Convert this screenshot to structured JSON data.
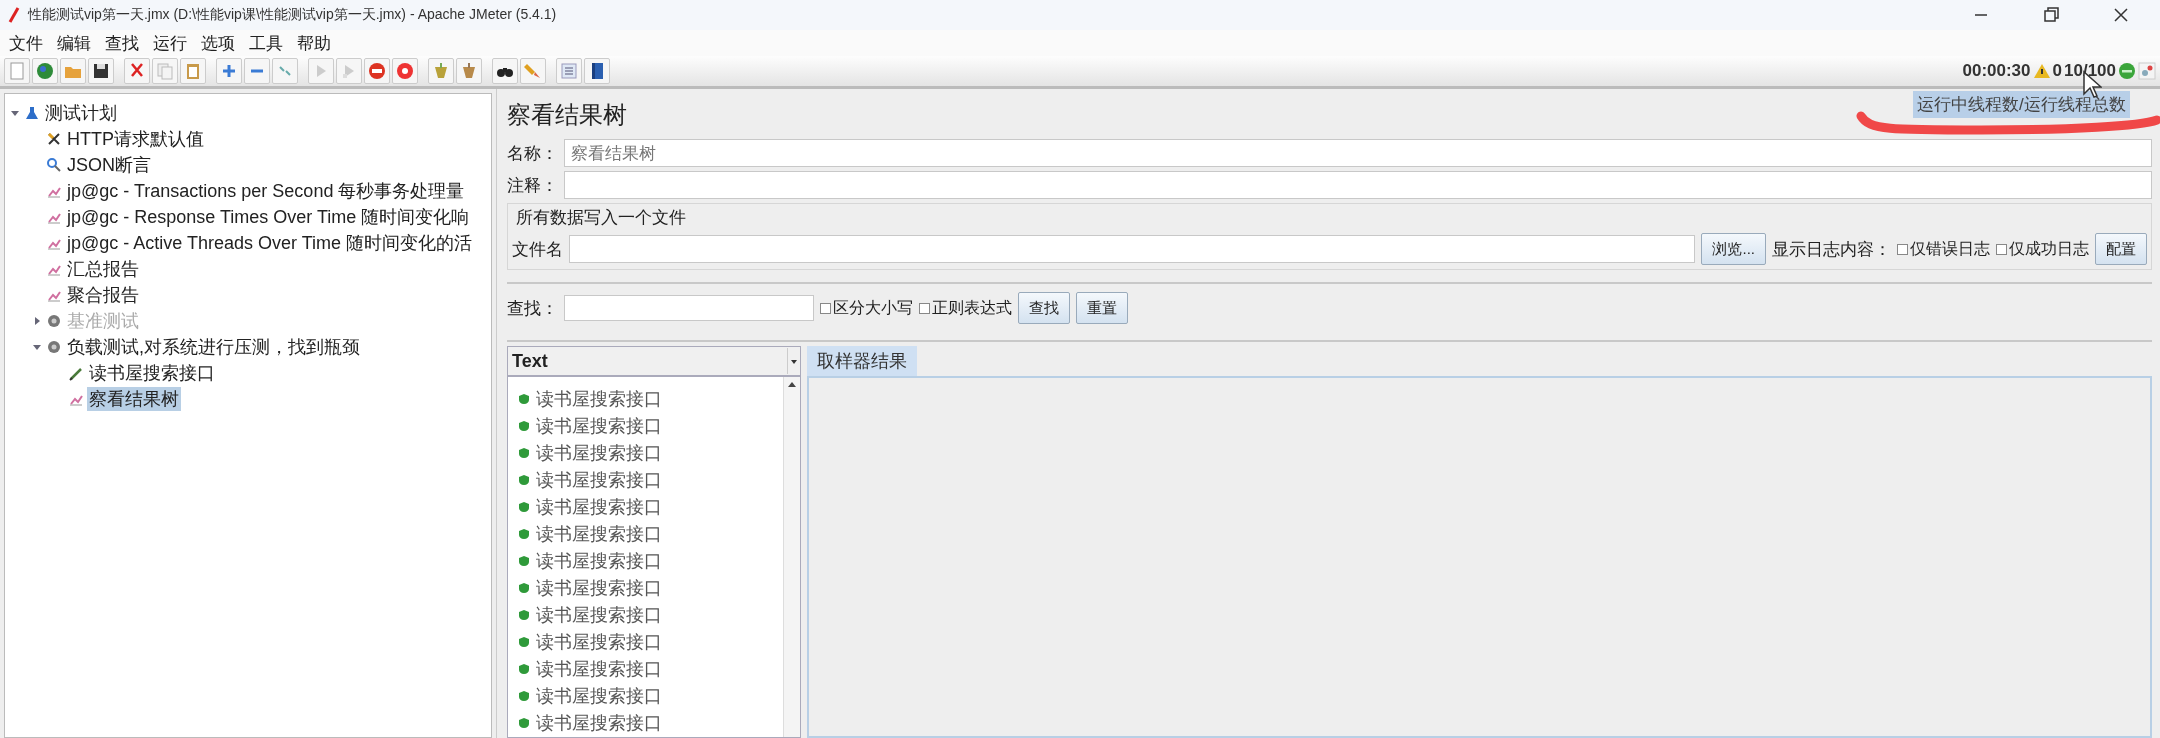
{
  "window": {
    "title": "性能测试vip第一天.jmx (D:\\性能vip课\\性能测试vip第一天.jmx) - Apache JMeter (5.4.1)"
  },
  "menu": [
    "文件",
    "编辑",
    "查找",
    "运行",
    "选项",
    "工具",
    "帮助"
  ],
  "status": {
    "elapsed": "00:00:30",
    "warnings": "0",
    "threads": "10/100",
    "tooltip": "运行中线程数/运行线程总数"
  },
  "tree": [
    {
      "label": "测试计划",
      "kind": "plan",
      "expanded": true,
      "disabled": false,
      "selected": false,
      "children": [
        {
          "label": "HTTP请求默认值",
          "kind": "config",
          "disabled": false,
          "selected": false
        },
        {
          "label": "JSON断言",
          "kind": "assertion",
          "disabled": false,
          "selected": false
        },
        {
          "label": "jp@gc - Transactions per Second 每秒事务处理量",
          "kind": "listener",
          "disabled": false,
          "selected": false
        },
        {
          "label": "jp@gc - Response Times Over Time 随时间变化响",
          "kind": "listener",
          "disabled": false,
          "selected": false
        },
        {
          "label": "jp@gc - Active Threads Over Time 随时间变化的活",
          "kind": "listener",
          "disabled": false,
          "selected": false
        },
        {
          "label": "汇总报告",
          "kind": "listener",
          "disabled": false,
          "selected": false
        },
        {
          "label": "聚合报告",
          "kind": "listener",
          "disabled": false,
          "selected": false
        },
        {
          "label": "基准测试",
          "kind": "thread_group",
          "expanded": false,
          "disabled": true,
          "selected": false
        },
        {
          "label": "负载测试,对系统进行压测，找到瓶颈",
          "kind": "thread_group",
          "expanded": true,
          "disabled": false,
          "selected": false,
          "children": [
            {
              "label": "读书屋搜索接口",
              "kind": "sampler",
              "disabled": false,
              "selected": false
            },
            {
              "label": "察看结果树",
              "kind": "listener",
              "disabled": false,
              "selected": true
            }
          ]
        }
      ]
    }
  ],
  "panel": {
    "title": "察看结果树",
    "name_field": {
      "label": "名称：",
      "value": "察看结果树"
    },
    "comment_field": {
      "label": "注释："
    },
    "file_group": {
      "title": "所有数据写入一个文件",
      "file_label": "文件名",
      "browse_button": "浏览...",
      "log_label": "显示日志内容：",
      "options": [
        {
          "label": "仅错误日志",
          "checked": false
        },
        {
          "label": "仅成功日志",
          "checked": false
        }
      ],
      "config_button": "配置"
    },
    "search": {
      "label": "查找：",
      "options": [
        {
          "label": "区分大小写",
          "checked": false
        },
        {
          "label": "正则表达式",
          "checked": false
        }
      ],
      "find_button": "查找",
      "reset_button": "重置"
    },
    "renderer": "Text",
    "results": [
      {
        "label": "读书屋搜索接口",
        "kind": "success"
      },
      {
        "label": "读书屋搜索接口",
        "kind": "success"
      },
      {
        "label": "读书屋搜索接口",
        "kind": "success"
      },
      {
        "label": "读书屋搜索接口",
        "kind": "success"
      },
      {
        "label": "读书屋搜索接口",
        "kind": "success"
      },
      {
        "label": "读书屋搜索接口",
        "kind": "success"
      },
      {
        "label": "读书屋搜索接口",
        "kind": "success"
      },
      {
        "label": "读书屋搜索接口",
        "kind": "success"
      },
      {
        "label": "读书屋搜索接口",
        "kind": "success"
      },
      {
        "label": "读书屋搜索接口",
        "kind": "success"
      },
      {
        "label": "读书屋搜索接口",
        "kind": "success"
      },
      {
        "label": "读书屋搜索接口",
        "kind": "success"
      },
      {
        "label": "读书屋搜索接口",
        "kind": "success"
      }
    ],
    "tabs": [
      {
        "label": "取样器结果",
        "selected": true
      }
    ]
  }
}
